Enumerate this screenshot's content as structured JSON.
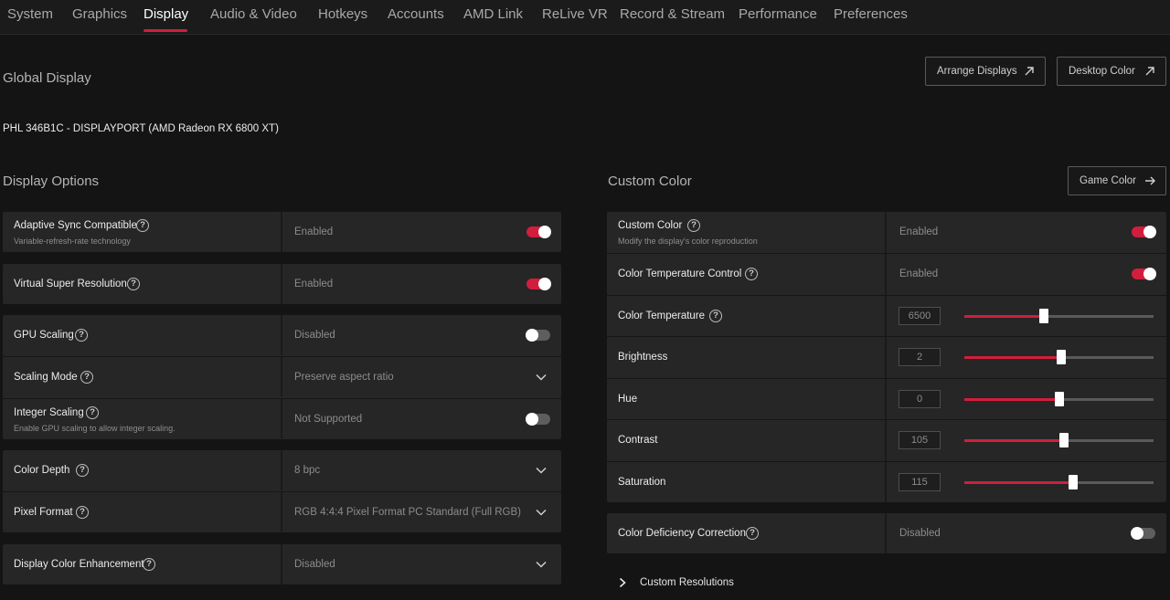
{
  "nav": {
    "tabs": [
      "System",
      "Graphics",
      "Display",
      "Audio & Video",
      "Hotkeys",
      "Accounts",
      "AMD Link",
      "ReLive VR",
      "Record & Stream",
      "Performance",
      "Preferences"
    ],
    "active": "Display"
  },
  "global": {
    "title": "Global Display",
    "arrange_displays": "Arrange Displays",
    "desktop_color": "Desktop Color",
    "monitor": "PHL 346B1C - DISPLAYPORT (AMD Radeon RX 6800 XT)"
  },
  "display_options": {
    "title": "Display Options",
    "adaptive_sync": {
      "label": "Adaptive Sync Compatible",
      "sub": "Variable-refresh-rate technology",
      "value": "Enabled",
      "on": true
    },
    "vsr": {
      "label": "Virtual Super Resolution",
      "value": "Enabled",
      "on": true
    },
    "gpu_scaling": {
      "label": "GPU Scaling",
      "value": "Disabled",
      "on": false
    },
    "scaling_mode": {
      "label": "Scaling Mode",
      "value": "Preserve aspect ratio"
    },
    "integer_scaling": {
      "label": "Integer Scaling",
      "sub": "Enable GPU scaling to allow integer scaling.",
      "value": "Not Supported",
      "on": false
    },
    "color_depth": {
      "label": "Color Depth",
      "value": "8 bpc"
    },
    "pixel_format": {
      "label": "Pixel Format",
      "value": "RGB 4:4:4 Pixel Format PC Standard (Full RGB)"
    },
    "color_enhancement": {
      "label": "Display Color Enhancement",
      "value": "Disabled"
    }
  },
  "custom_color": {
    "title": "Custom Color",
    "game_color": "Game Color",
    "custom_color_row": {
      "label": "Custom Color",
      "sub": "Modify the display's color reproduction",
      "value": "Enabled",
      "on": true
    },
    "temp_control": {
      "label": "Color Temperature Control",
      "value": "Enabled",
      "on": true
    },
    "sliders": [
      {
        "label": "Color Temperature",
        "value": "6500",
        "fill": 0.42,
        "help": true
      },
      {
        "label": "Brightness",
        "value": "2",
        "fill": 0.51,
        "help": false
      },
      {
        "label": "Hue",
        "value": "0",
        "fill": 0.5,
        "help": false
      },
      {
        "label": "Contrast",
        "value": "105",
        "fill": 0.525,
        "help": false
      },
      {
        "label": "Saturation",
        "value": "115",
        "fill": 0.575,
        "help": false
      }
    ],
    "deficiency": {
      "label": "Color Deficiency Correction",
      "value": "Disabled",
      "on": false
    },
    "custom_resolutions": "Custom Resolutions"
  },
  "colors": {
    "accent": "#d11e3d",
    "panel": "#262626",
    "background": "#141414"
  }
}
